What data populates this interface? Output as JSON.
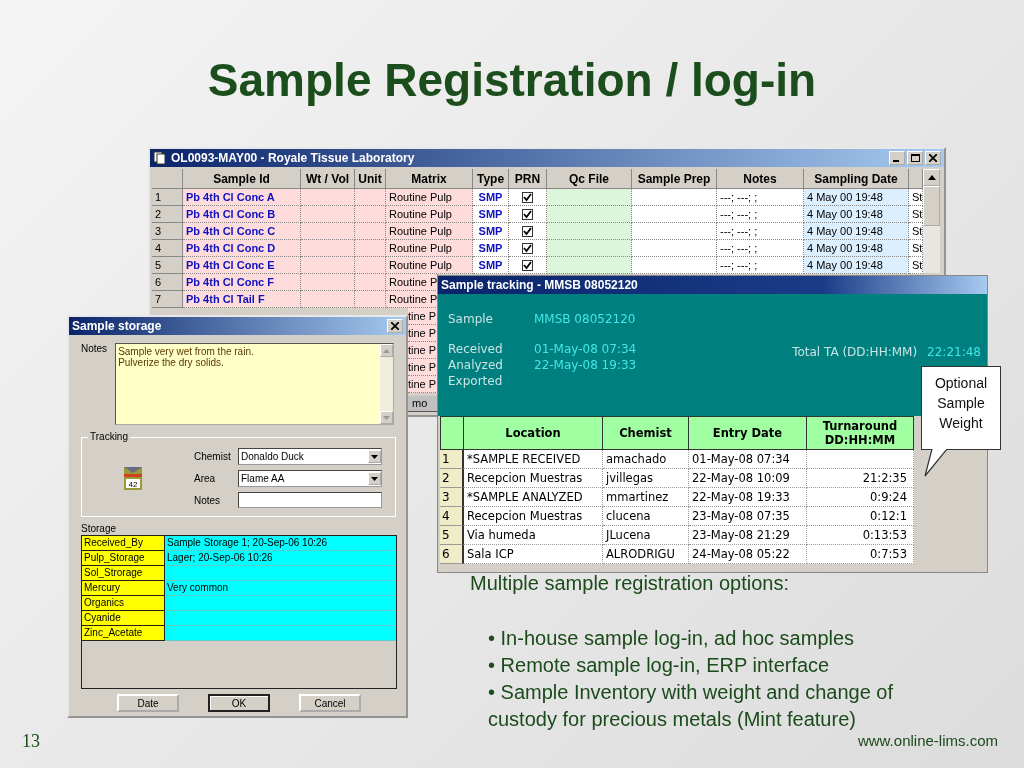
{
  "slide": {
    "title": "Sample Registration / log-in",
    "page_number": "13",
    "footer_url": "www.online-lims.com"
  },
  "grid_window": {
    "title": "OL0093-MAY00 - Royale Tissue Laboratory",
    "columns": [
      "Sample Id",
      "Wt / Vol",
      "Unit",
      "Matrix",
      "Type",
      "PRN",
      "Qc File",
      "Sample Prep",
      "Notes",
      "Sampling Date"
    ],
    "rows": [
      {
        "number": "1",
        "sample_id": "Pb 4th Cl Conc A",
        "matrix": "Routine Pulp",
        "type": "SMP",
        "prn_checked": true,
        "notes": "---; ---; ;",
        "sampling_date": "4 May 00 19:48",
        "column_12": "St"
      },
      {
        "number": "2",
        "sample_id": "Pb 4th Cl Conc B",
        "matrix": "Routine Pulp",
        "type": "SMP",
        "prn_checked": true,
        "notes": "---; ---; ;",
        "sampling_date": "4 May 00 19:48",
        "column_12": "St"
      },
      {
        "number": "3",
        "sample_id": "Pb 4th Cl Conc C",
        "matrix": "Routine Pulp",
        "type": "SMP",
        "prn_checked": true,
        "notes": "---; ---; ;",
        "sampling_date": "4 May 00 19:48",
        "column_12": "St"
      },
      {
        "number": "4",
        "sample_id": "Pb 4th Cl Conc D",
        "matrix": "Routine Pulp",
        "type": "SMP",
        "prn_checked": true,
        "notes": "---; ---; ;",
        "sampling_date": "4 May 00 19:48",
        "column_12": "St"
      },
      {
        "number": "5",
        "sample_id": "Pb 4th Cl Conc E",
        "matrix": "Routine Pulp",
        "type": "SMP",
        "prn_checked": true,
        "notes": "---; ---; ;",
        "sampling_date": "4 May 00 19:48",
        "column_12": "St"
      },
      {
        "number": "6",
        "sample_id": "Pb 4th Cl Conc F",
        "matrix": "Routine P"
      },
      {
        "number": "7",
        "sample_id": "Pb 4th Cl Tail F",
        "matrix": "Routine P"
      },
      {
        "matrix": "tine P"
      },
      {
        "matrix": "tine P"
      },
      {
        "matrix": "tine P"
      },
      {
        "matrix": "tine P"
      },
      {
        "matrix": "tine P"
      }
    ],
    "sheet_tab": "mo"
  },
  "storage_window": {
    "title": "Sample storage",
    "notes_label": "Notes",
    "notes": [
      "Sample very wet from the rain.",
      "Pulverize the dry solids."
    ],
    "tracking": {
      "legend": "Tracking",
      "icon_number": "42",
      "fields": [
        {
          "kind": "dropdown",
          "label": "Chemist",
          "value": "Donaldo Duck"
        },
        {
          "kind": "dropdown",
          "label": "Area",
          "value": "Flame AA"
        },
        {
          "kind": "text",
          "label": "Notes"
        }
      ]
    },
    "storage_label": "Storage",
    "storage": [
      {
        "key": "Received_By",
        "value": "Sample Storage 1; 20-Sep-06 10:26"
      },
      {
        "key": "Pulp_Storage",
        "value": "Lager; 20-Sep-06 10:26"
      },
      {
        "key": "Sol_Strorage"
      },
      {
        "key": "Mercury",
        "value": "Very common"
      },
      {
        "key": "Organics"
      },
      {
        "key": "Cyanide"
      },
      {
        "key": "Zinc_Acetate"
      }
    ],
    "buttons": [
      {
        "label": "Date",
        "default": false
      },
      {
        "label": "OK",
        "default": true
      },
      {
        "label": "Cancel",
        "default": false
      }
    ]
  },
  "tracking_window": {
    "title": "Sample tracking - MMSB 08052120",
    "info": [
      {
        "label": "Sample",
        "value": "MMSB 08052120"
      },
      {
        "label": "Received",
        "value": "01-May-08 07:34"
      },
      {
        "label": "Analyzed",
        "value": "22-May-08 19:33"
      },
      {
        "label": "Exported"
      }
    ],
    "total_label": "Total TA (DD:HH:MM)",
    "total_value": "22:21:48",
    "columns": [
      "Location",
      "Chemist",
      "Entry Date",
      "Turnaround DD:HH:MM"
    ],
    "rows": [
      {
        "number": "1",
        "location": "*SAMPLE RECEIVED",
        "chemist": "amachado",
        "entry_date": "01-May-08 07:34"
      },
      {
        "number": "2",
        "location": "Recepcion Muestras",
        "chemist": "jvillegas",
        "entry_date": "22-May-08 10:09",
        "turnaround": "21:2:35"
      },
      {
        "number": "3",
        "location": "*SAMPLE ANALYZED",
        "chemist": "mmartinez",
        "entry_date": "22-May-08 19:33",
        "turnaround": "0:9:24"
      },
      {
        "number": "4",
        "location": "Recepcion Muestras",
        "chemist": "clucena",
        "entry_date": "23-May-08 07:35",
        "turnaround": "0:12:1"
      },
      {
        "number": "5",
        "location": "Via humeda",
        "chemist": "JLucena",
        "entry_date": "23-May-08 21:29",
        "turnaround": "0:13:53"
      },
      {
        "number": "6",
        "location": "Sala ICP",
        "chemist": "ALRODRIGU",
        "entry_date": "24-May-08 05:22",
        "turnaround": "0:7:53"
      }
    ]
  },
  "callout": "Optional Sample Weight",
  "text_block": {
    "heading": "Multiple sample registration options:",
    "bullets": [
      "• In-house sample log-in, ad hoc samples",
      "• Remote sample log-in, ERP interface",
      "• Sample Inventory with weight and change of custody for precious metals (Mint feature)"
    ]
  }
}
